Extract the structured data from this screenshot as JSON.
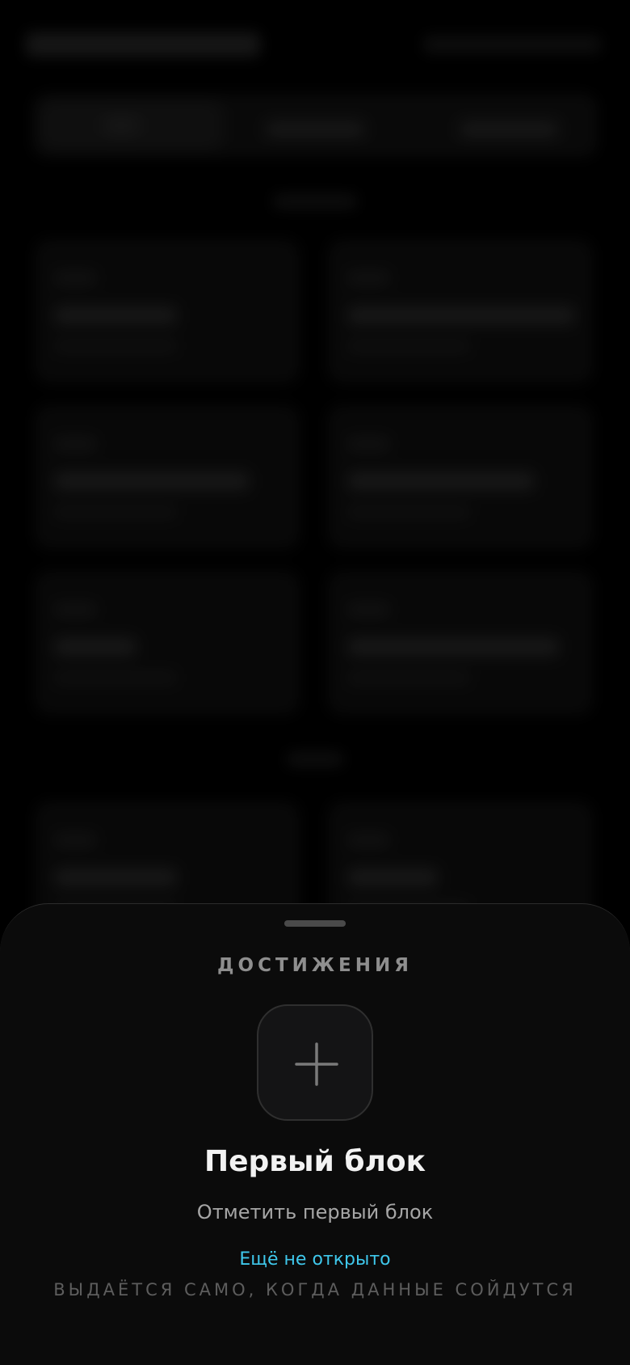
{
  "sheet": {
    "header": "ДОСТИЖЕНИЯ",
    "icon": "plus-icon",
    "title": "Первый блок",
    "subtitle": "Отметить первый блок",
    "status": "Ещё не открыто",
    "hint": "ВЫДАЁТСЯ САМО, КОГДА ДАННЫЕ СОЙДУТСЯ"
  },
  "colors": {
    "background": "#000000",
    "sheet_background": "#0b0b0b",
    "accent": "#3fc8ec",
    "header_text": "#8e8e8e",
    "muted_text": "#5d5d5d"
  }
}
